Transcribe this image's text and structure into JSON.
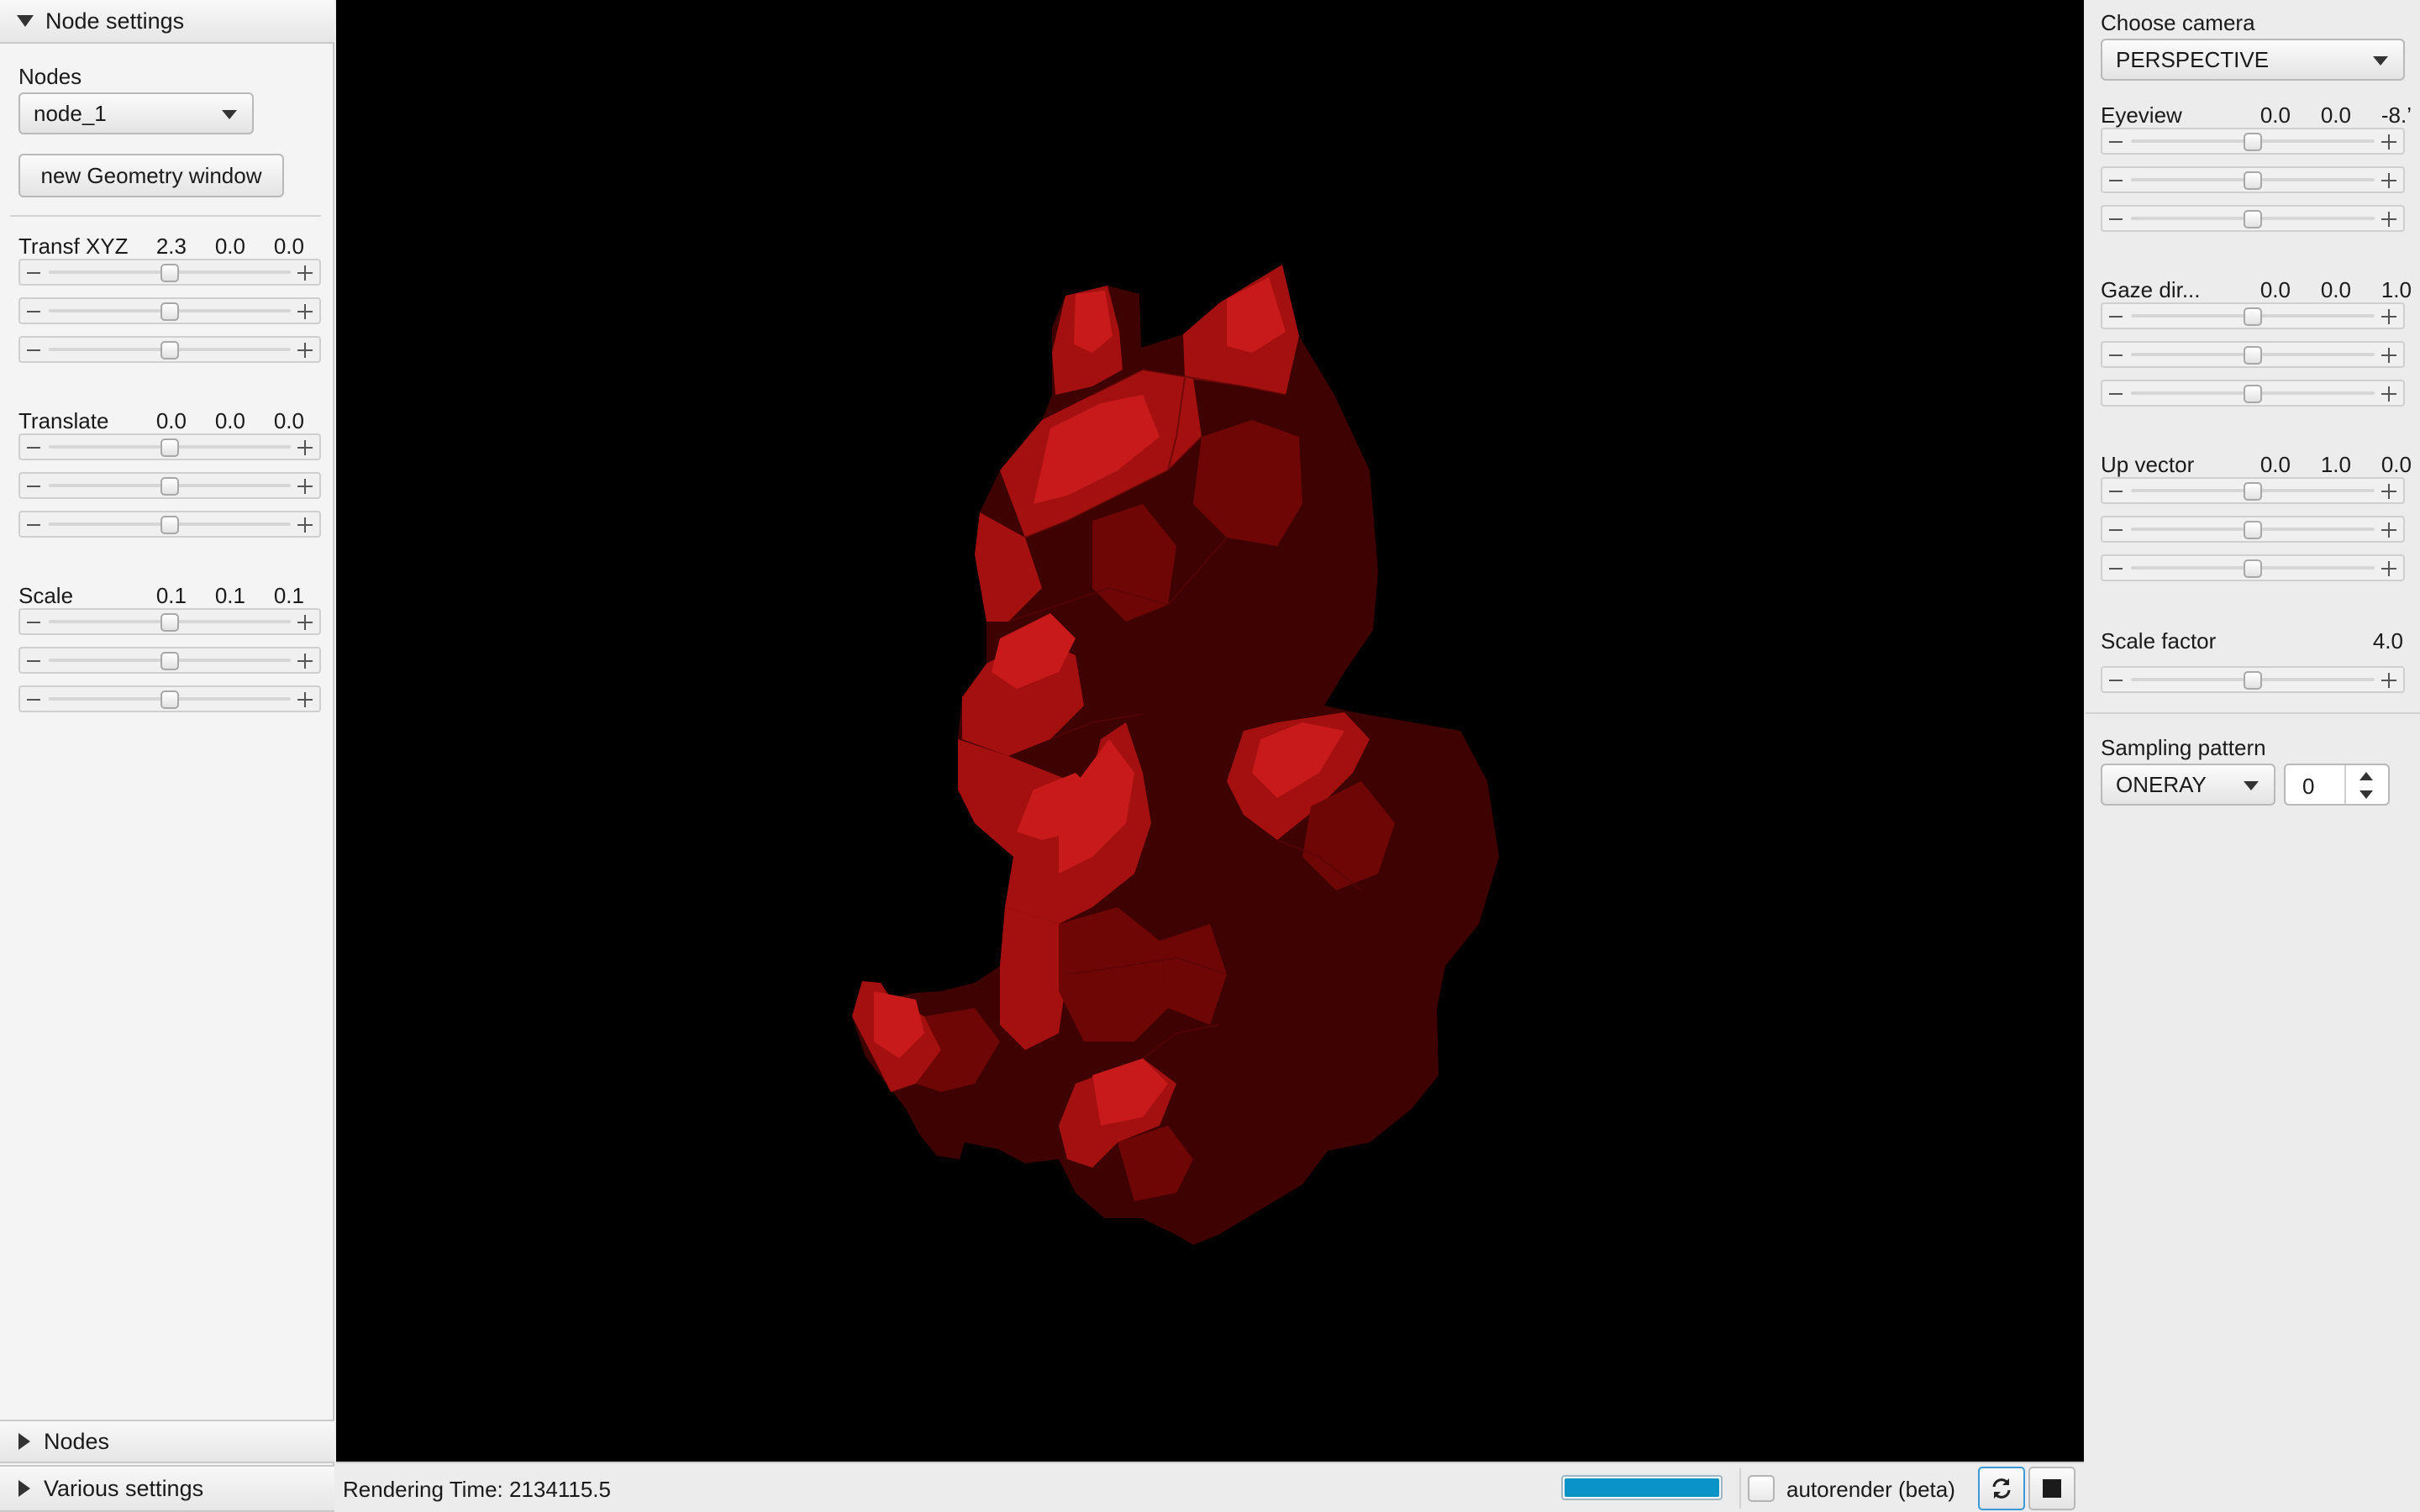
{
  "left_panel": {
    "title": "Node settings",
    "nodes_label": "Nodes",
    "node_select_value": "node_1",
    "new_geometry_button": "new Geometry window",
    "groups": [
      {
        "label": "Transf XYZ",
        "values": [
          "2.3",
          "0.0",
          "0.0"
        ],
        "slider_levels": [
          0.5,
          0.5,
          0.5
        ]
      },
      {
        "label": "Translate",
        "values": [
          "0.0",
          "0.0",
          "0.0"
        ],
        "slider_levels": [
          0.5,
          0.5,
          0.5
        ]
      },
      {
        "label": "Scale",
        "values": [
          "0.1",
          "0.1",
          "0.1"
        ],
        "slider_levels": [
          0.5,
          0.5,
          0.5
        ]
      }
    ],
    "bottom_sections": [
      "Nodes",
      "Various settings"
    ]
  },
  "right_panel": {
    "camera_label": "Choose camera",
    "camera_value": "PERSPECTIVE",
    "groups": [
      {
        "label": "Eyeview",
        "values": [
          "0.0",
          "0.0",
          "-8.’"
        ],
        "slider_levels": [
          0.5,
          0.5,
          0.5
        ]
      },
      {
        "label": "Gaze dir...",
        "values": [
          "0.0",
          "0.0",
          "1.0"
        ],
        "slider_levels": [
          0.5,
          0.5,
          0.5
        ]
      },
      {
        "label": "Up vector",
        "values": [
          "0.0",
          "1.0",
          "0.0"
        ],
        "slider_levels": [
          0.5,
          0.5,
          0.5
        ]
      }
    ],
    "scale_factor_label": "Scale factor",
    "scale_factor_value": "4.0",
    "scale_factor_level": 0.5,
    "sampling_label": "Sampling pattern",
    "sampling_value": "ONERAY",
    "sampling_count": "0"
  },
  "status_bar": {
    "rendering_time": "Rendering Time: 2134115.5",
    "progress": 1.0,
    "autorender_label": "autorender (beta)",
    "autorender_checked": false
  },
  "viewport": {
    "background": "#000000",
    "model_color": "#b01818",
    "model_icon": "red-bear-mesh"
  },
  "icons": {
    "refresh": "refresh-icon",
    "stop": "stop-icon"
  }
}
